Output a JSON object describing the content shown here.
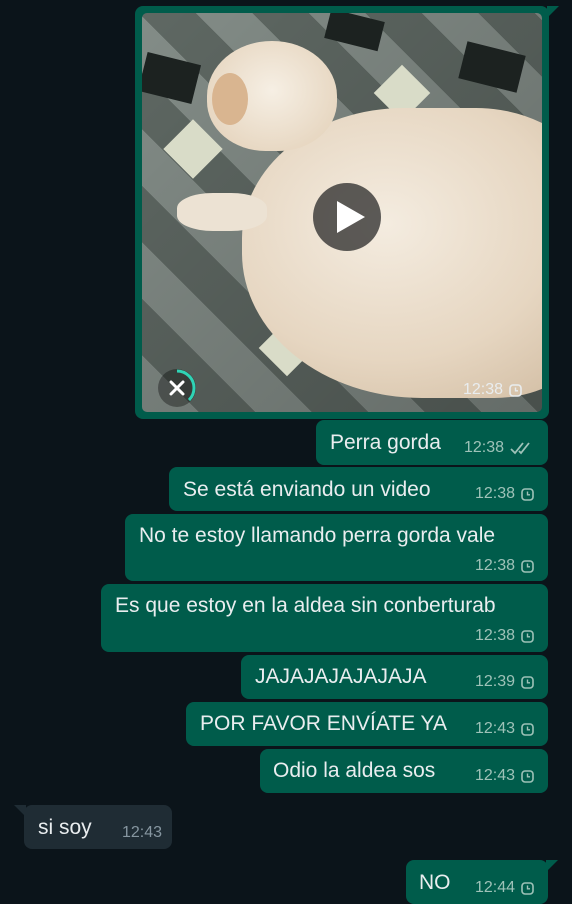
{
  "video": {
    "time": "12:38",
    "play_icon": "play-icon",
    "cancel_icon": "cancel-upload-icon"
  },
  "messages": [
    {
      "text": "Perra gorda",
      "time": "12:38",
      "status": "read",
      "direction": "out"
    },
    {
      "text": "Se está enviando un video",
      "time": "12:38",
      "status": "pending",
      "direction": "out"
    },
    {
      "text": "No te estoy llamando perra gorda vale",
      "time": "12:38",
      "status": "pending",
      "direction": "out"
    },
    {
      "text": "Es que estoy en la aldea sin conberturab",
      "time": "12:38",
      "status": "pending",
      "direction": "out"
    },
    {
      "text": "JAJAJAJAJAJAJA",
      "time": "12:39",
      "status": "pending",
      "direction": "out"
    },
    {
      "text": "POR FAVOR ENVÍATE YA",
      "time": "12:43",
      "status": "pending",
      "direction": "out"
    },
    {
      "text": "Odio la aldea sos",
      "time": "12:43",
      "status": "pending",
      "direction": "out"
    },
    {
      "text": "si soy",
      "time": "12:43",
      "status": "",
      "direction": "in"
    },
    {
      "text": "NO",
      "time": "12:44",
      "status": "pending",
      "direction": "out"
    }
  ],
  "colors": {
    "outgoing": "#005c4b",
    "incoming": "#1f2c34",
    "background": "#0b141a",
    "read_ticks": "#9ec2b8"
  }
}
